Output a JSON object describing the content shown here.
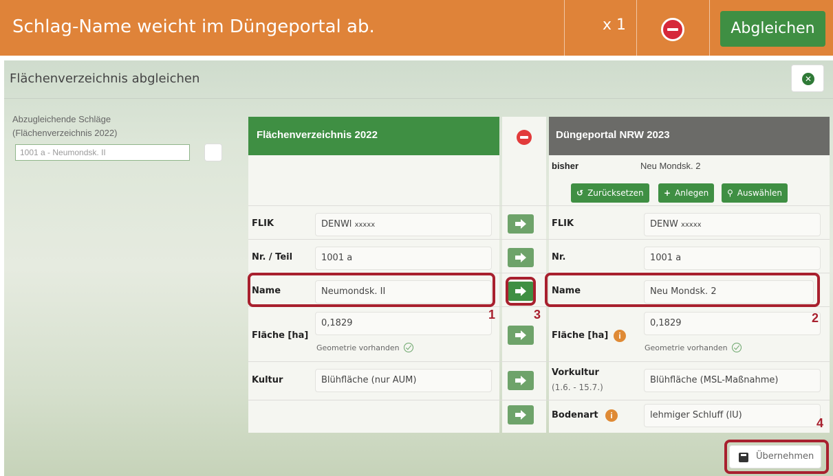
{
  "topbar": {
    "title": "Schlag-Name weicht im Düngeportal ab.",
    "count": "x 1",
    "sync_label": "Abgleichen",
    "color": "#df8339",
    "remove_icon": "minus-circle-icon"
  },
  "panel": {
    "title": "Flächenverzeichnis abgleichen",
    "close_icon": "close-circle-icon"
  },
  "left": {
    "label_line1": "Abzugleichende Schläge",
    "label_line2": "(Flächenverzeichnis 2022)",
    "selected": "1001 a - Neumondsk. II"
  },
  "table": {
    "header_left": "Flächenverzeichnis 2022",
    "header_right": "Düngeportal NRW 2023",
    "bisher_label": "bisher",
    "bisher_value": "Neu Mondsk. 2",
    "btn_reset": "Zurücksetzen",
    "btn_create": "Anlegen",
    "btn_select": "Auswählen",
    "left_rows": {
      "flik_label": "FLIK",
      "flik_value": "DENWl",
      "flik_mask": "xxxxx",
      "nr_label": "Nr. / Teil",
      "nr_value": "1001 a",
      "name_label": "Name",
      "name_value": "Neumondsk. II",
      "flaeche_label": "Fläche [ha]",
      "flaeche_value": "0,1829",
      "geometry": "Geometrie vorhanden",
      "kultur_label": "Kultur",
      "kultur_value": "Blühfläche (nur AUM)"
    },
    "right_rows": {
      "flik_label": "FLIK",
      "flik_value": "DENW",
      "flik_mask": "xxxxx",
      "nr_label": "Nr.",
      "nr_value": "1001 a",
      "name_label": "Name",
      "name_value": "Neu Mondsk. 2",
      "flaeche_label": "Fläche [ha]",
      "flaeche_value": "0,1829",
      "geometry": "Geometrie vorhanden",
      "vorkultur_label": "Vorkultur",
      "vorkultur_sub": "(1.6. - 15.7.)",
      "vorkultur_value": "Blühfläche (MSL-Maßnahme)",
      "bodenart_label": "Bodenart",
      "bodenart_value": "lehmiger Schluff (lU)"
    },
    "info_glyph": "i"
  },
  "callouts": {
    "n1": "1",
    "n2": "2",
    "n3": "3",
    "n4": "4",
    "color": "#a8202e"
  },
  "save_label": "Übernehmen"
}
